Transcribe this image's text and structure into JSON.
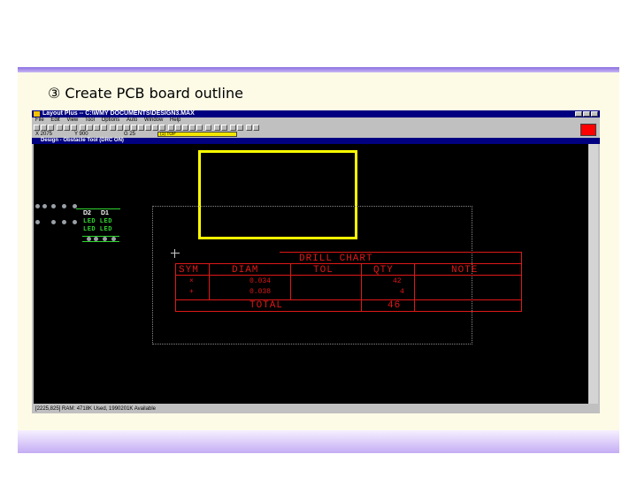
{
  "slide": {
    "title": "③ Create PCB board outline"
  },
  "app": {
    "title": "Layout Plus -- C:\\WMY DOCUMENTS\\DESIGN3.MAX",
    "menu": [
      "File",
      "Edit",
      "View",
      "Tool",
      "Options",
      "Auto",
      "Window",
      "Help"
    ],
    "coord_x": "X  2075",
    "coord_y": "Y  900",
    "grid": "G  25",
    "layer": "(1) TOP",
    "design_window_title": "Design - Obstacle Tool (DRC ON)",
    "status": "[2225,825]  RAM: 4718K Used, 1990201K Available",
    "accent_color": "#000080",
    "outline_color": "#ffff00",
    "drill_color": "#e01818"
  },
  "parts": {
    "ref_left": "D2",
    "ref_right": "D1",
    "value_row1": "LED LED",
    "value_row2": "LED LED"
  },
  "drill_chart": {
    "title": "DRILL CHART",
    "headers": [
      "SYM",
      "DIAM",
      "TOL",
      "QTY",
      "NOTE"
    ],
    "rows": [
      {
        "sym": "×",
        "diam": "0.034",
        "qty": "42"
      },
      {
        "sym": "+",
        "diam": "0.038",
        "qty": "4"
      }
    ],
    "total_label": "TOTAL",
    "total_qty": "46"
  }
}
